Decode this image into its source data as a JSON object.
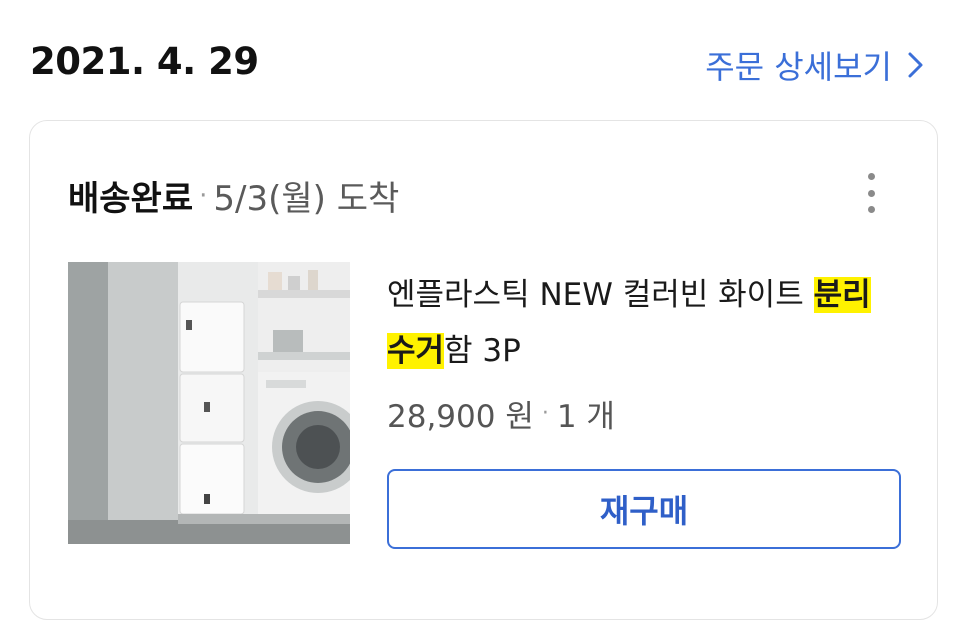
{
  "order": {
    "date": "2021. 4. 29",
    "detail_link_label": "주문 상세보기"
  },
  "card": {
    "status": "배송완료",
    "separator": "·",
    "arrival": "5/3(월) 도착",
    "product": {
      "name_part1": "엔플라스틱 NEW 컬러빈 화이트 ",
      "name_highlight1": "분리",
      "name_highlight2": "수거",
      "name_part2": "함 3P",
      "price": "28,900 원",
      "quantity": "1 개"
    },
    "rebuy_label": "재구매"
  },
  "colors": {
    "accent": "#3b6fd8",
    "highlight": "#fff200",
    "border": "#e4e4e4"
  },
  "icons": [
    "chevron-right-icon",
    "more-vertical-icon"
  ]
}
